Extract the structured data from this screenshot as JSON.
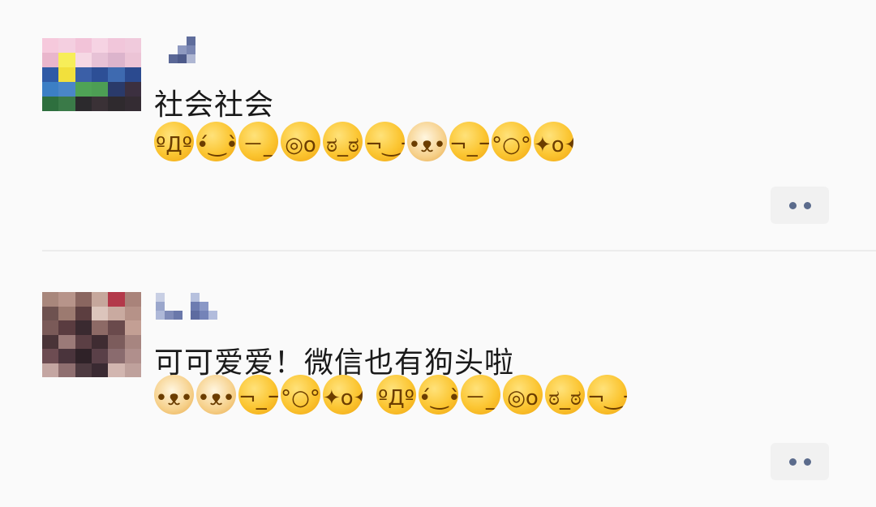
{
  "posts": [
    {
      "text": "社会社会",
      "emojis": [
        {
          "name": "eating-watermelon-emoji",
          "glyph": "ºДº"
        },
        {
          "name": "headband-emoji",
          "glyph": "•́‿•̀"
        },
        {
          "name": "sweat-emoji",
          "glyph": "－_－"
        },
        {
          "name": "monocle-emoji",
          "glyph": "◎o"
        },
        {
          "name": "grumpy-emoji",
          "glyph": "ಠ_ಠ"
        },
        {
          "name": "smirk-emoji",
          "glyph": "¬‿¬"
        },
        {
          "name": "doge-emoji",
          "glyph": "•ᴥ•"
        },
        {
          "name": "okay-emoji",
          "glyph": "¬_¬"
        },
        {
          "name": "facepalm-emoji",
          "glyph": "°○°"
        },
        {
          "name": "starstruck-emoji",
          "glyph": "✦o✦"
        }
      ],
      "more_label": "more"
    },
    {
      "text": "可可爱爱！微信也有狗头啦",
      "emojis": [
        {
          "name": "doge-emoji",
          "glyph": "•ᴥ•"
        },
        {
          "name": "doge-emoji",
          "glyph": "•ᴥ•"
        },
        {
          "name": "okay-emoji",
          "glyph": "¬_¬"
        },
        {
          "name": "facepalm-emoji",
          "glyph": "°○°"
        },
        {
          "name": "starstruck-emoji",
          "glyph": "✦o✦"
        },
        {
          "name": "eating-watermelon-emoji",
          "glyph": "ºДº"
        },
        {
          "name": "headband-emoji",
          "glyph": "•́‿•̀"
        },
        {
          "name": "sweat-emoji",
          "glyph": "－_－"
        },
        {
          "name": "monocle-emoji",
          "glyph": "◎o"
        },
        {
          "name": "grumpy-emoji",
          "glyph": "ಠ_ಠ"
        },
        {
          "name": "smirk-emoji",
          "glyph": "¬‿¬"
        }
      ],
      "more_label": "more"
    }
  ],
  "colors": {
    "background": "#fafafa",
    "text": "#1a1a1a",
    "more_dots": "#5b6b8c",
    "more_bg": "#f1f1f1"
  }
}
